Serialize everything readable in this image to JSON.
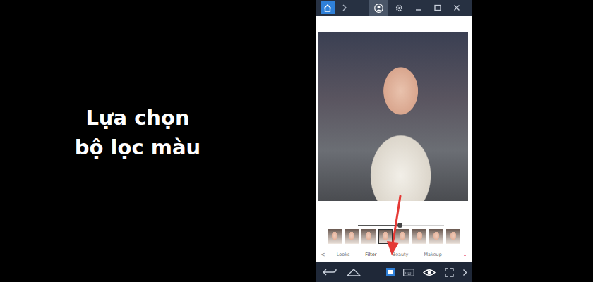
{
  "caption": {
    "lines": [
      "Lựa chọn",
      "bộ lọc màu"
    ]
  },
  "editor": {
    "intensity": {
      "level": 0.48
    },
    "filters": [
      {
        "selected": false
      },
      {
        "selected": false
      },
      {
        "selected": false
      },
      {
        "selected": true
      },
      {
        "selected": false
      },
      {
        "selected": false
      },
      {
        "selected": false
      },
      {
        "selected": false
      }
    ],
    "back": "<",
    "tabs": [
      {
        "label": "Looks",
        "selected": false
      },
      {
        "label": "Filter",
        "selected": true
      },
      {
        "label": "Beauty",
        "selected": false
      },
      {
        "label": "Makeup",
        "selected": false
      }
    ]
  }
}
